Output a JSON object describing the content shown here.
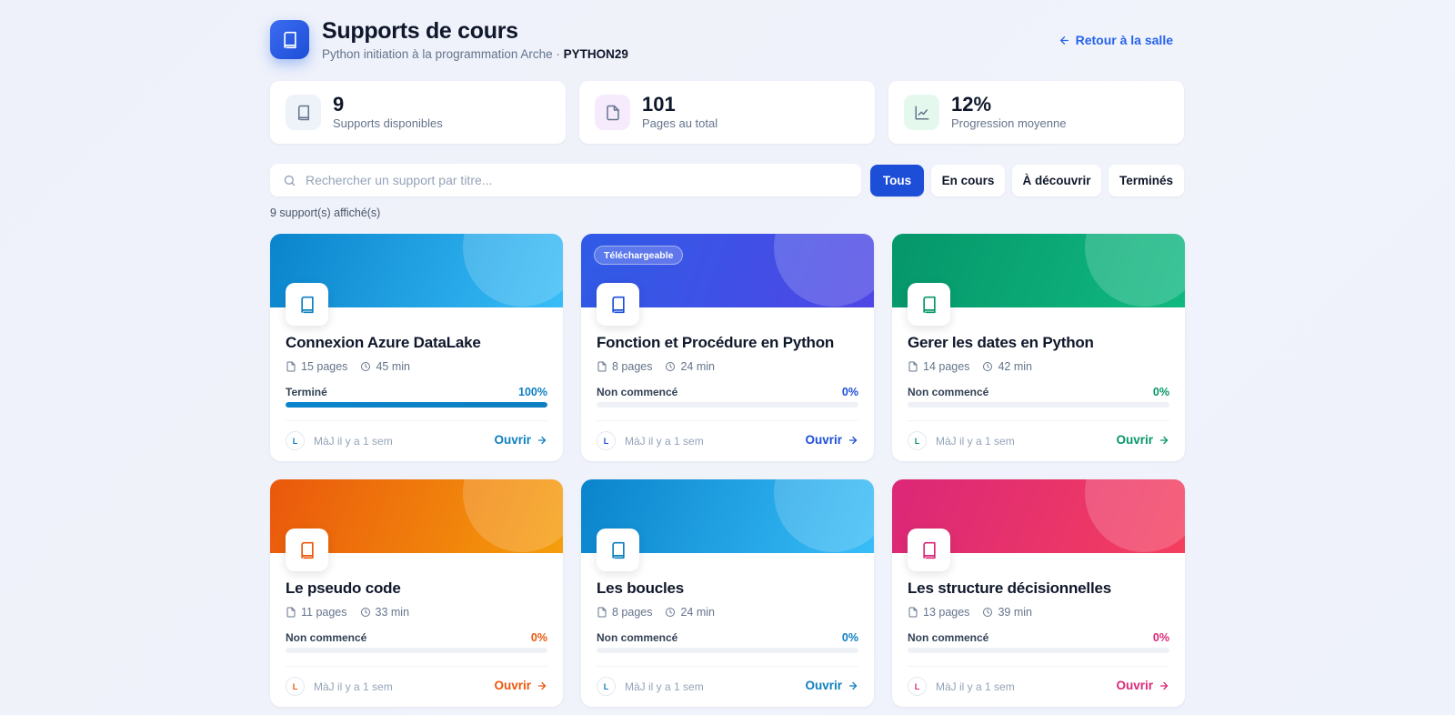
{
  "header": {
    "title": "Supports de cours",
    "subtitle": "Python initiation à la programmation Arche",
    "separator": "·",
    "course_code": "PYTHON29",
    "back_label": "Retour à la salle"
  },
  "stats": [
    {
      "value": "9",
      "label": "Supports disponibles",
      "icon": "book-icon"
    },
    {
      "value": "101",
      "label": "Pages au total",
      "icon": "file-icon"
    },
    {
      "value": "12%",
      "label": "Progression moyenne",
      "icon": "chart-icon"
    }
  ],
  "search": {
    "placeholder": "Rechercher un support par titre..."
  },
  "filters": [
    {
      "label": "Tous",
      "active": true
    },
    {
      "label": "En cours",
      "active": false
    },
    {
      "label": "À découvrir",
      "active": false
    },
    {
      "label": "Terminés",
      "active": false
    }
  ],
  "results_count": "9 support(s) affiché(s)",
  "cards": [
    {
      "title": "Connexion Azure DataLake",
      "pages": "15 pages",
      "duration": "45 min",
      "status": "Terminé",
      "progress_label": "100%",
      "progress": 1.0,
      "badge": "",
      "avatar": "L",
      "updated": "MàJ il y a 1 sem",
      "open_label": "Ouvrir",
      "accent": "#0e7fc0",
      "gradient": [
        "#0a84cc",
        "#38bdf8"
      ]
    },
    {
      "title": "Fonction et Procédure en Python",
      "pages": "8 pages",
      "duration": "24 min",
      "status": "Non commencé",
      "progress_label": "0%",
      "progress": 0,
      "badge": "Téléchargeable",
      "avatar": "L",
      "updated": "MàJ il y a 1 sem",
      "open_label": "Ouvrir",
      "accent": "#1d4ed8",
      "gradient": [
        "#2f5be6",
        "#4f46e5"
      ]
    },
    {
      "title": "Gerer les dates en Python",
      "pages": "14 pages",
      "duration": "42 min",
      "status": "Non commencé",
      "progress_label": "0%",
      "progress": 0,
      "badge": "",
      "avatar": "L",
      "updated": "MàJ il y a 1 sem",
      "open_label": "Ouvrir",
      "accent": "#059669",
      "gradient": [
        "#059669",
        "#10b981"
      ]
    },
    {
      "title": "Le pseudo code",
      "pages": "11 pages",
      "duration": "33 min",
      "status": "Non commencé",
      "progress_label": "0%",
      "progress": 0,
      "badge": "",
      "avatar": "L",
      "updated": "MàJ il y a 1 sem",
      "open_label": "Ouvrir",
      "accent": "#ea580c",
      "gradient": [
        "#ea580c",
        "#f59e0b"
      ]
    },
    {
      "title": "Les boucles",
      "pages": "8 pages",
      "duration": "24 min",
      "status": "Non commencé",
      "progress_label": "0%",
      "progress": 0,
      "badge": "",
      "avatar": "L",
      "updated": "MàJ il y a 1 sem",
      "open_label": "Ouvrir",
      "accent": "#0e7fc0",
      "gradient": [
        "#0a84cc",
        "#38bdf8"
      ]
    },
    {
      "title": "Les structure décisionnelles",
      "pages": "13 pages",
      "duration": "39 min",
      "status": "Non commencé",
      "progress_label": "0%",
      "progress": 0,
      "badge": "",
      "avatar": "L",
      "updated": "MàJ il y a 1 sem",
      "open_label": "Ouvrir",
      "accent": "#db2777",
      "gradient": [
        "#db2777",
        "#f43f5e"
      ]
    }
  ]
}
